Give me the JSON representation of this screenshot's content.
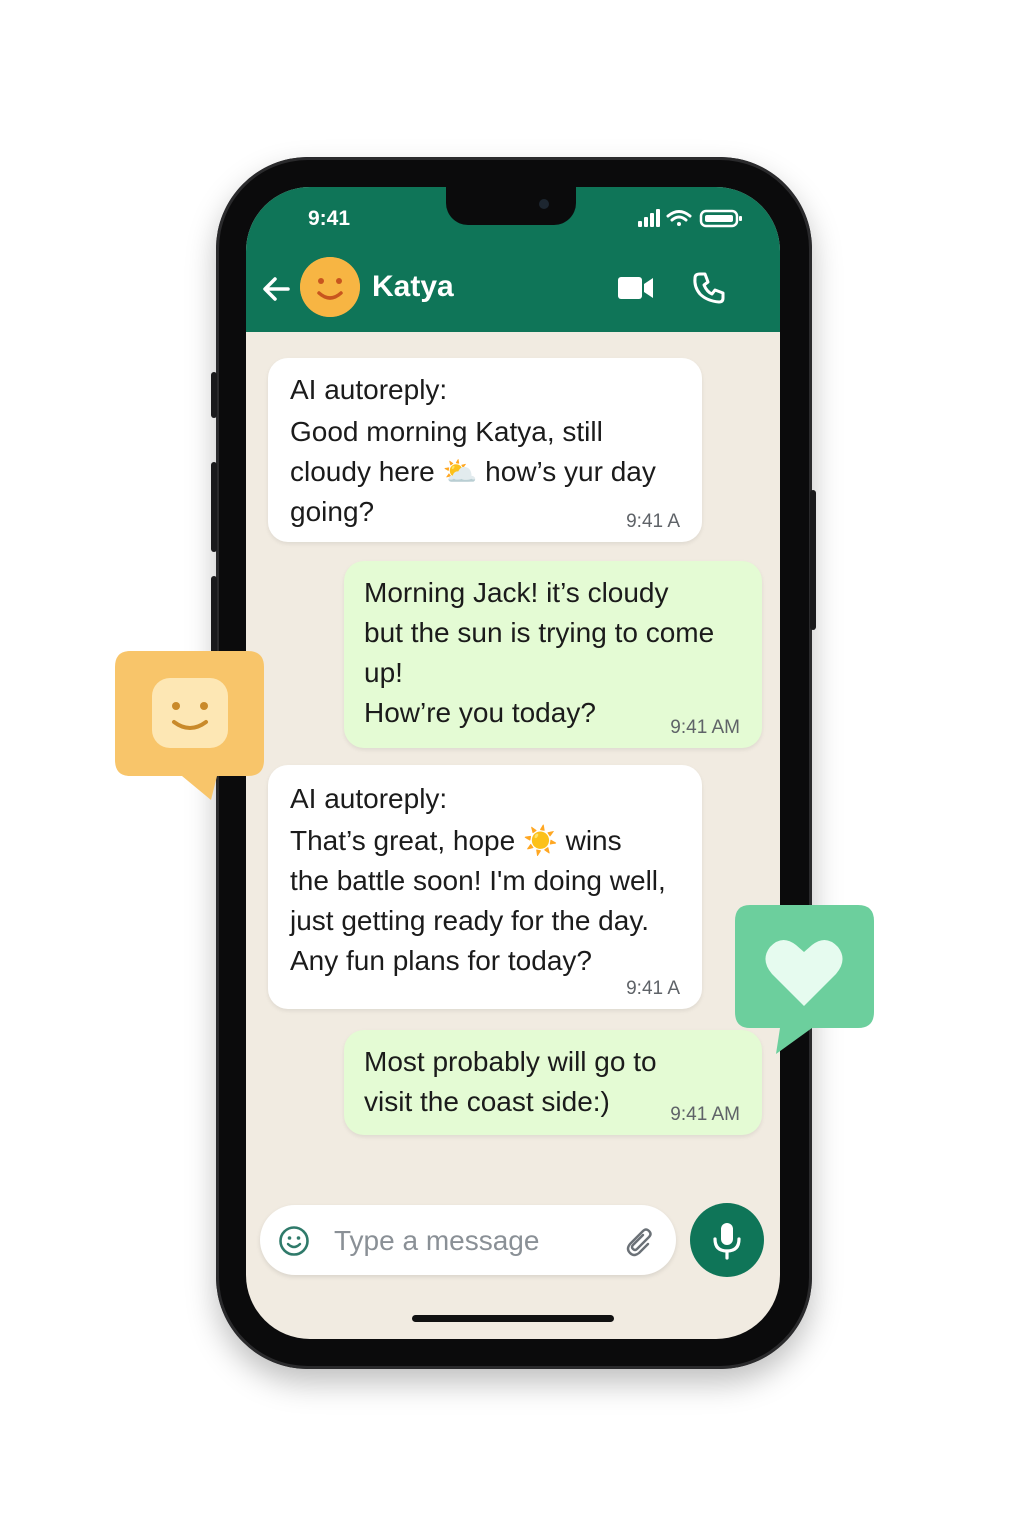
{
  "status_bar": {
    "time": "9:41"
  },
  "header": {
    "contact_name": "Katya"
  },
  "messages": [
    {
      "direction": "in",
      "label": "AI autoreply:",
      "text": "Good morning Katya, still\ncloudy here ⛅ how’s yur day\ngoing?",
      "time": "9:41 A"
    },
    {
      "direction": "out",
      "text": "Morning Jack! it’s cloudy\nbut the sun is trying to come\nup!\nHow’re you today?",
      "time": "9:41 AM"
    },
    {
      "direction": "in",
      "label": "AI autoreply:",
      "text": "That’s great, hope ☀️ wins\nthe battle soon! I'm doing well,\njust getting ready for the day.\nAny fun plans for today?",
      "time": "9:41 A"
    },
    {
      "direction": "out",
      "text": "Most probably will go to\nvisit the coast side:)",
      "time": "9:41 AM"
    }
  ],
  "composer": {
    "placeholder": "Type a message"
  },
  "colors": {
    "header": "#0f7558",
    "chat_bg": "#f1ebe1",
    "outgoing": "#e4fbd4",
    "incoming": "#ffffff",
    "smiley_badge": "#f8c56a",
    "heart_badge": "#6ccf9d"
  },
  "icons": [
    "back-arrow-icon",
    "avatar-smiley-icon",
    "video-call-icon",
    "phone-call-icon",
    "signal-icon",
    "wifi-icon",
    "battery-icon",
    "emoji-icon",
    "attachment-icon",
    "microphone-icon",
    "smiley-badge-icon",
    "heart-badge-icon"
  ]
}
